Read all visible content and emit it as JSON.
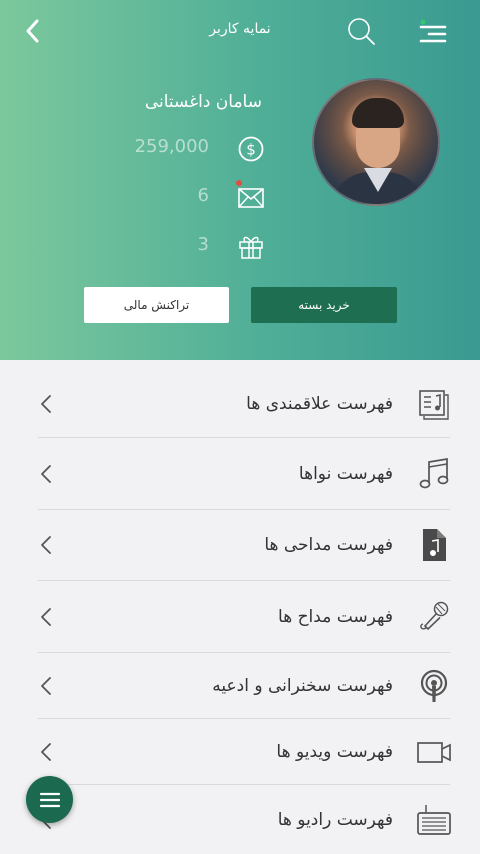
{
  "header": {
    "title": "نمایه کاربر",
    "user_name": "سامان داغستانی",
    "balance": "259,000",
    "messages_count": "6",
    "gifts_count": "3",
    "buy_package_label": "خرید بسته",
    "financial_transaction_label": "تراکنش مالی"
  },
  "colors": {
    "header_gradient_start": "#7cc89d",
    "header_gradient_end": "#3a9a91",
    "primary_dark": "#1e6e52",
    "notification_dot": "#e05040"
  },
  "list": {
    "items": [
      {
        "label": "فهرست علاقمندی ها",
        "icon": "favorites-list-icon"
      },
      {
        "label": "فهرست نواها",
        "icon": "music-note-icon"
      },
      {
        "label": "فهرست مداحی ها",
        "icon": "audio-file-icon"
      },
      {
        "label": "فهرست مداح ها",
        "icon": "microphone-icon"
      },
      {
        "label": "فهرست سخنرانی و ادعیه",
        "icon": "podcast-icon"
      },
      {
        "label": "فهرست ویدیو ها",
        "icon": "video-camera-icon"
      },
      {
        "label": "فهرست رادیو ها",
        "icon": "radio-icon"
      }
    ]
  }
}
